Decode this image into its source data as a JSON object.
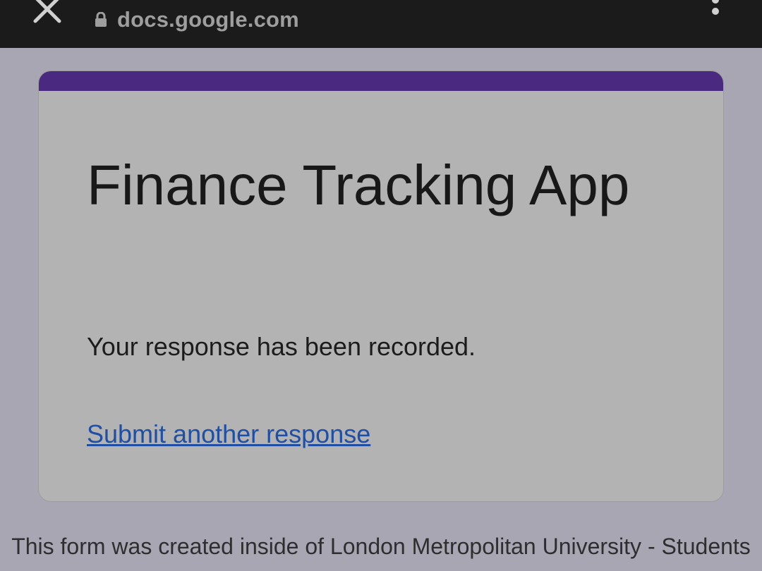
{
  "browser": {
    "url": "docs.google.com",
    "close_icon": "close-icon",
    "lock_icon": "lock-icon",
    "menu_icon": "more-vertical-icon"
  },
  "form": {
    "title": "Finance Tracking App",
    "confirmation": "Your response has been recorded.",
    "submit_another": "Submit another response",
    "accent_color": "#4a2a80"
  },
  "footer": {
    "note": "This form was created inside of London Metropolitan University - Students"
  }
}
